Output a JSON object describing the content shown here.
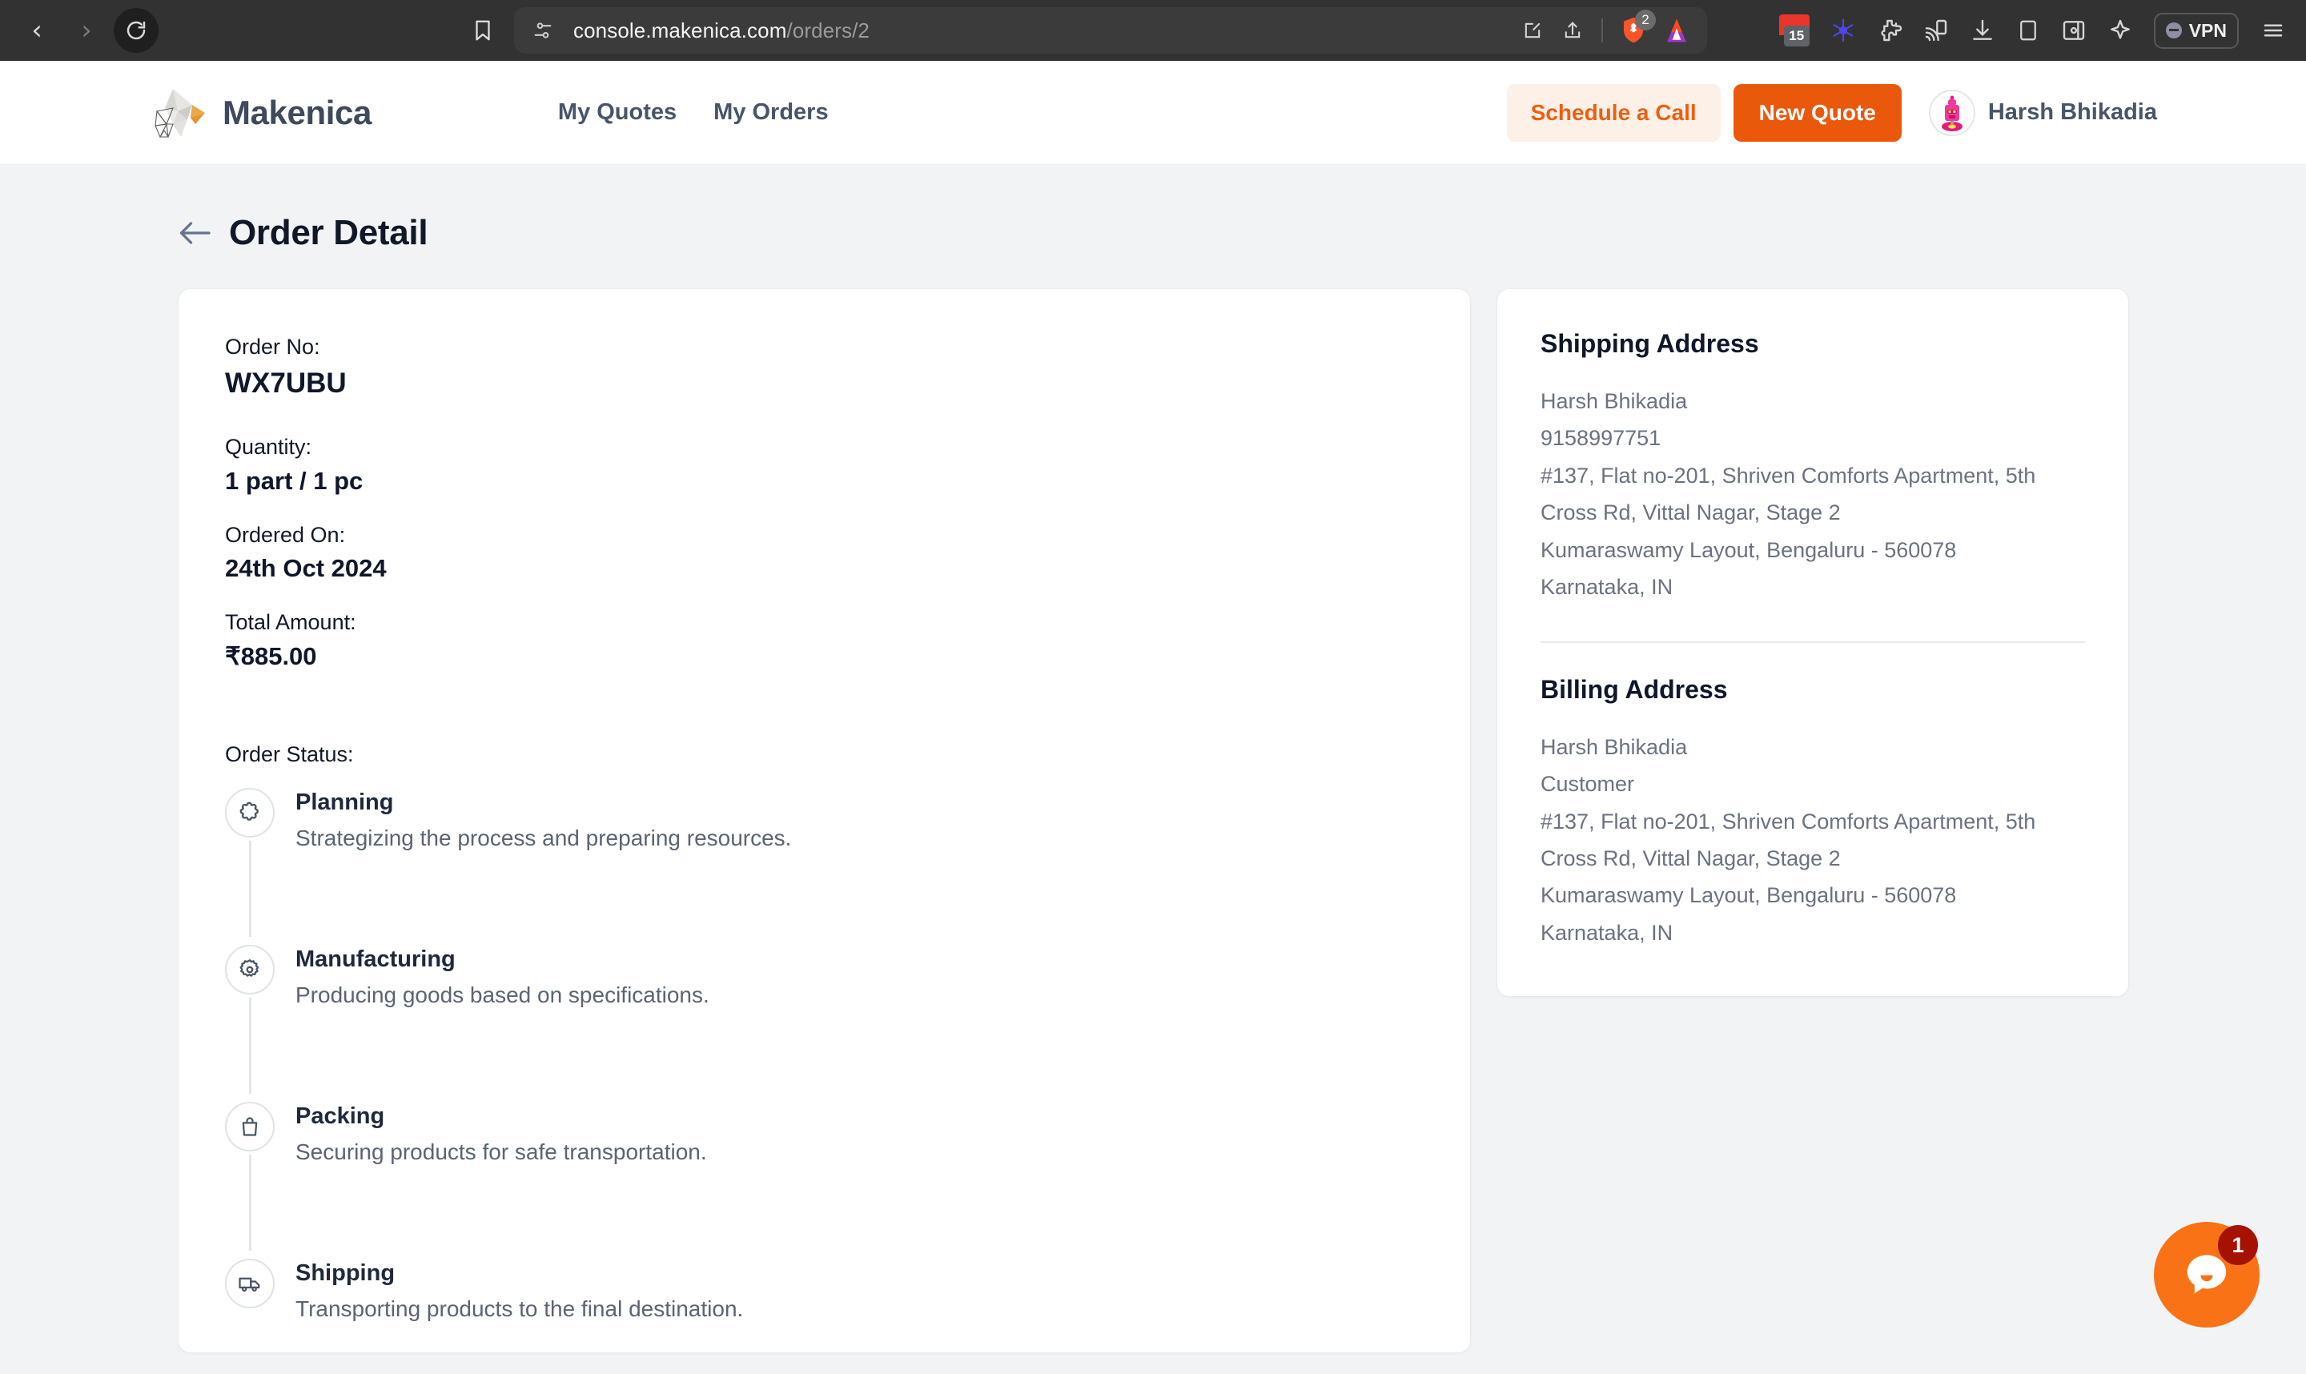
{
  "browser": {
    "url_host": "console.makenica.com",
    "url_path": "/orders/2",
    "back_icon": "back-chevron-icon",
    "forward_icon": "forward-chevron-icon",
    "reload_icon": "reload-icon",
    "bookmark_icon": "bookmark-icon",
    "tune_icon": "site-settings-icon",
    "shield_badge": "2",
    "calendar_badge": "15",
    "vpn_label": "VPN",
    "menu_icon": "hamburger-menu-icon"
  },
  "header": {
    "brand": "Makenica",
    "nav": [
      {
        "label": "My Quotes"
      },
      {
        "label": "My Orders"
      }
    ],
    "schedule_label": "Schedule a Call",
    "new_quote_label": "New Quote",
    "user_name": "Harsh Bhikadia",
    "accent_orange": "#ea580c",
    "accent_soft": "#fdf0e6"
  },
  "page": {
    "title": "Order Detail",
    "back_icon": "back-arrow-icon"
  },
  "order": {
    "order_no_label": "Order No:",
    "order_no_value": "WX7UBU",
    "quantity_label": "Quantity:",
    "quantity_value": "1 part / 1 pc",
    "ordered_on_label": "Ordered On:",
    "ordered_on_value": "24th Oct 2024",
    "total_label": "Total Amount:",
    "total_value": "₹885.00",
    "status_label": "Order Status:",
    "steps": [
      {
        "icon": "puzzle-piece-icon",
        "title": "Planning",
        "desc": "Strategizing the process and preparing resources."
      },
      {
        "icon": "gear-icon",
        "title": "Manufacturing",
        "desc": "Producing goods based on specifications."
      },
      {
        "icon": "shopping-bag-icon",
        "title": "Packing",
        "desc": "Securing products for safe transportation."
      },
      {
        "icon": "truck-icon",
        "title": "Shipping",
        "desc": "Transporting products to the final destination."
      }
    ]
  },
  "shipping_address": {
    "title": "Shipping Address",
    "lines": [
      "Harsh Bhikadia",
      "9158997751",
      "#137, Flat no-201, Shriven Comforts Apartment, 5th Cross Rd, Vittal Nagar, Stage 2",
      "Kumaraswamy Layout, Bengaluru - 560078",
      "Karnataka, IN"
    ]
  },
  "billing_address": {
    "title": "Billing Address",
    "lines": [
      "Harsh Bhikadia",
      "Customer",
      "#137, Flat no-201, Shriven Comforts Apartment, 5th Cross Rd, Vittal Nagar, Stage 2",
      "Kumaraswamy Layout, Bengaluru - 560078",
      "Karnataka, IN"
    ]
  },
  "chat": {
    "icon": "chat-bubble-icon",
    "badge": "1",
    "color": "#f97316"
  }
}
